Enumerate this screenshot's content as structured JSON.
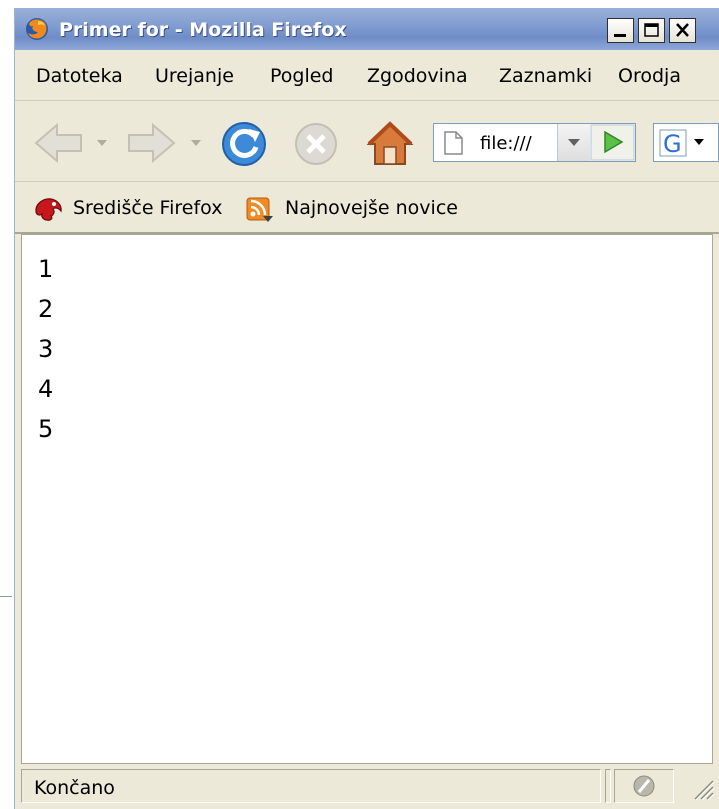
{
  "window": {
    "title": "Primer for - Mozilla Firefox",
    "accent": "#7f9bd0"
  },
  "menu": {
    "items": [
      {
        "label": "Datoteka"
      },
      {
        "label": "Urejanje"
      },
      {
        "label": "Pogled"
      },
      {
        "label": "Zgodovina"
      },
      {
        "label": "Zaznamki"
      },
      {
        "label": "Orodja"
      }
    ]
  },
  "toolbar": {
    "icons": [
      "back-arrow-icon",
      "forward-arrow-icon",
      "reload-icon",
      "stop-icon",
      "home-icon"
    ],
    "url": "file:///",
    "search_engine_letter": "G"
  },
  "bookmarks": {
    "items": [
      {
        "label": "Središče Firefox",
        "icon": "firefox-hub-icon"
      },
      {
        "label": "Najnovejše novice",
        "icon": "rss-feed-icon"
      }
    ]
  },
  "content": {
    "lines": [
      "1",
      "2",
      "3",
      "4",
      "5"
    ]
  },
  "status": {
    "text": "Končano"
  }
}
